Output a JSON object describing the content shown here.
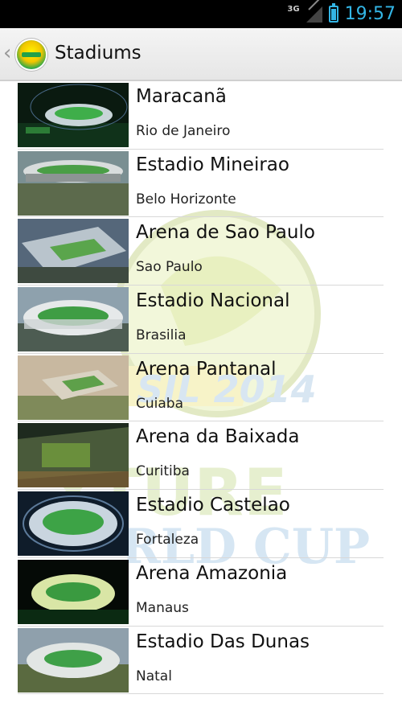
{
  "status_bar": {
    "network": "3G",
    "time": "19:57",
    "accent": "#33b5e5"
  },
  "action_bar": {
    "title": "Stadiums",
    "up_icon": "chevron-left-icon",
    "logo_icon": "app-logo-icon"
  },
  "stadiums": [
    {
      "name": "Maracanã",
      "city": "Rio de Janeiro"
    },
    {
      "name": "Estadio Mineirao",
      "city": "Belo Horizonte"
    },
    {
      "name": "Arena de Sao Paulo",
      "city": "Sao Paulo"
    },
    {
      "name": "Estadio Nacional",
      "city": "Brasilia"
    },
    {
      "name": "Arena Pantanal",
      "city": "Cuiaba"
    },
    {
      "name": "Arena da Baixada",
      "city": "Curitiba"
    },
    {
      "name": "Estadio Castelao",
      "city": "Fortaleza"
    },
    {
      "name": "Arena Amazonia",
      "city": "Manaus"
    },
    {
      "name": "Estadio Das Dunas",
      "city": "Natal"
    }
  ],
  "watermark": {
    "line1": "SIL 2014",
    "line2": "XTURE",
    "line3": "RLD CUP"
  }
}
